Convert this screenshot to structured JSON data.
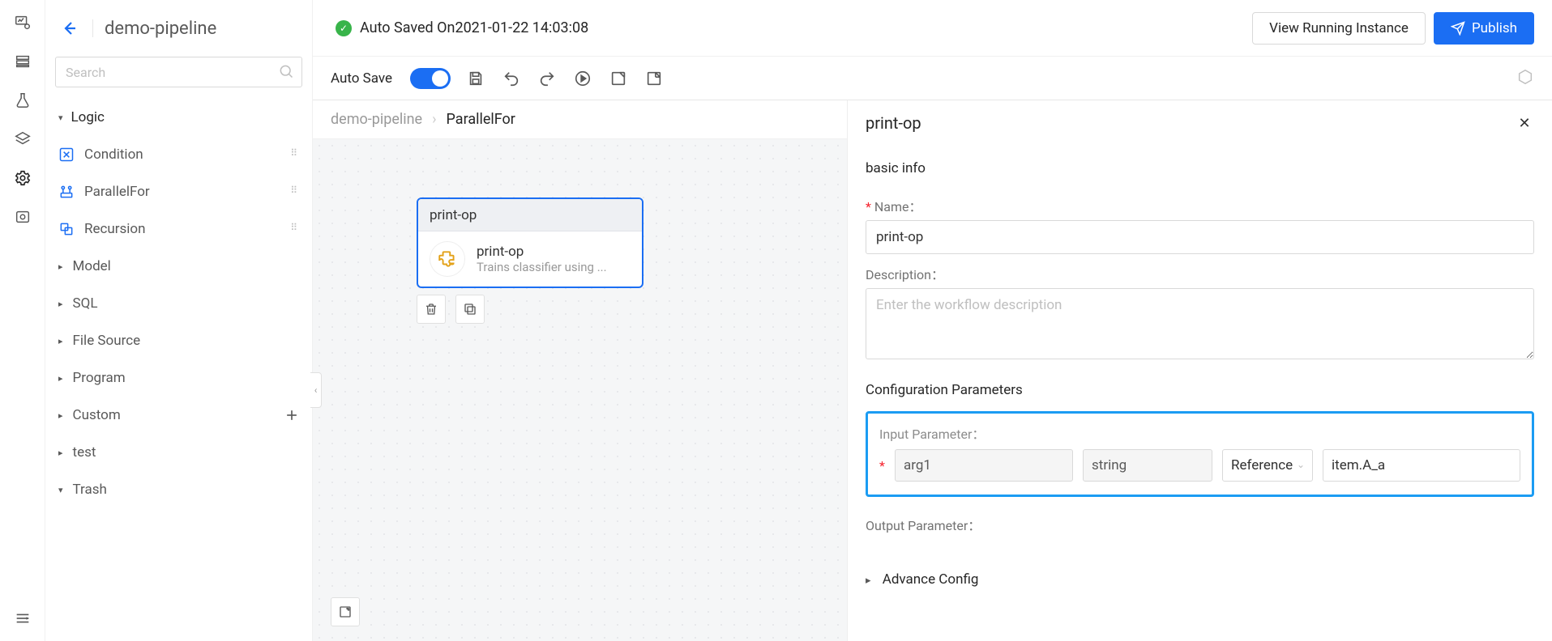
{
  "header": {
    "page_title": "demo-pipeline",
    "autosave_status": "Auto Saved On2021-01-22 14:03:08",
    "view_instance_label": "View Running Instance",
    "publish_label": "Publish"
  },
  "toolbar": {
    "autosave_label": "Auto Save",
    "autosave_on": true
  },
  "search": {
    "placeholder": "Search"
  },
  "sidebar": {
    "groups": [
      {
        "label": "Logic",
        "expanded": true,
        "items": [
          {
            "label": "Condition",
            "icon": "branch-icon",
            "draggable": true
          },
          {
            "label": "ParallelFor",
            "icon": "parallel-icon",
            "draggable": true
          },
          {
            "label": "Recursion",
            "icon": "recursion-icon",
            "draggable": true
          }
        ]
      },
      {
        "label": "Model",
        "expanded": false
      },
      {
        "label": "SQL",
        "expanded": false
      },
      {
        "label": "File Source",
        "expanded": false
      },
      {
        "label": "Program",
        "expanded": false
      },
      {
        "label": "Custom",
        "expanded": false,
        "has_add": true
      },
      {
        "label": "test",
        "expanded": false
      },
      {
        "label": "Trash",
        "expanded": false
      }
    ]
  },
  "breadcrumb": {
    "root": "demo-pipeline",
    "current": "ParallelFor"
  },
  "canvas": {
    "node": {
      "head": "print-op",
      "title": "print-op",
      "subtitle": "Trains classifier using ..."
    }
  },
  "panel": {
    "title": "print-op",
    "basic_info_title": "basic info",
    "name_label": "Name：",
    "name_value": "print-op",
    "description_label": "Description：",
    "description_placeholder": "Enter the workflow description",
    "config_title": "Configuration Parameters",
    "input_param_label": "Input Parameter：",
    "input_param": {
      "name": "arg1",
      "type": "string",
      "mode": "Reference",
      "value": "item.A_a"
    },
    "output_param_label": "Output Parameter：",
    "advance_config_label": "Advance Config"
  }
}
